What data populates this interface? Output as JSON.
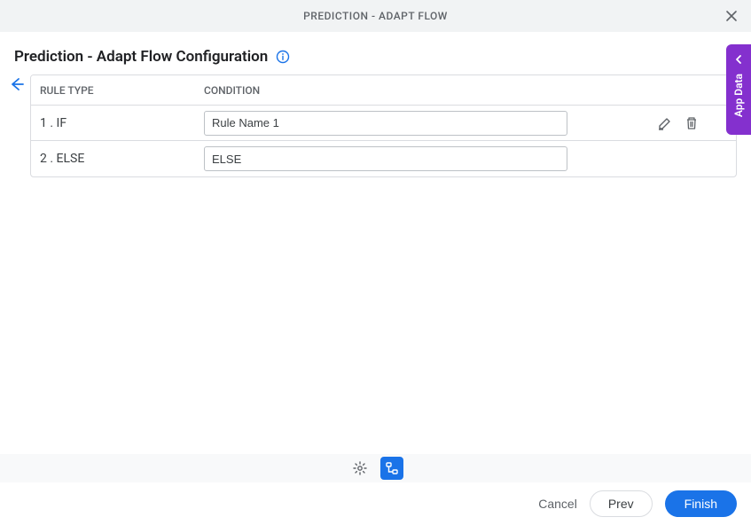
{
  "header": {
    "title": "PREDICTION - ADAPT FLOW"
  },
  "page": {
    "title": "Prediction - Adapt Flow Configuration"
  },
  "table": {
    "headers": {
      "type": "RULE TYPE",
      "condition": "CONDITION"
    },
    "rows": [
      {
        "type": "1 . IF",
        "condition": "Rule Name 1",
        "editable": true
      },
      {
        "type": "2 . ELSE",
        "condition": "ELSE",
        "editable": false
      }
    ]
  },
  "footer": {
    "cancel": "Cancel",
    "prev": "Prev",
    "finish": "Finish"
  },
  "sideTab": {
    "label": "App Data"
  }
}
